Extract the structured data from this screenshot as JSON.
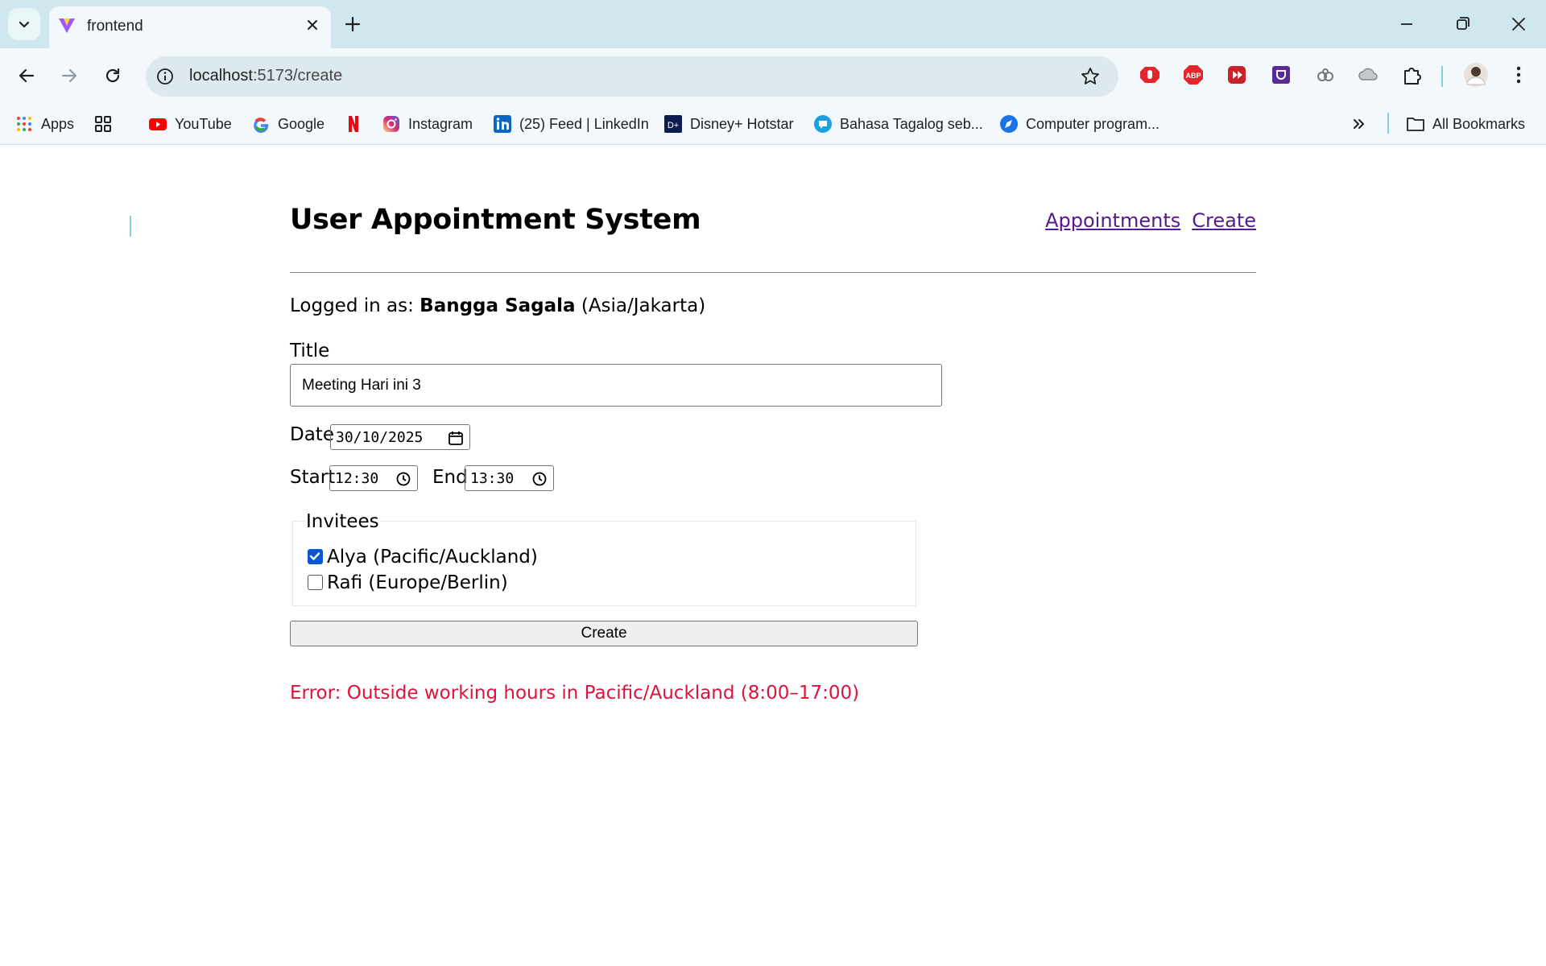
{
  "browser": {
    "tab_title": "frontend",
    "url_host": "localhost",
    "url_path": ":5173/create",
    "bookmarks": [
      {
        "label": "Apps",
        "icon": "apps-grid-icon"
      },
      {
        "label": "",
        "icon": "tab-groups-icon"
      },
      {
        "label": "YouTube",
        "icon": "youtube-icon"
      },
      {
        "label": "Google",
        "icon": "google-icon"
      },
      {
        "label": "",
        "icon": "netflix-icon"
      },
      {
        "label": "Instagram",
        "icon": "instagram-icon"
      },
      {
        "label": "(25) Feed | LinkedIn",
        "icon": "linkedin-icon"
      },
      {
        "label": "Disney+ Hotstar",
        "icon": "hotstar-icon"
      },
      {
        "label": "Bahasa Tagalog seb...",
        "icon": "chat-bubble-icon"
      },
      {
        "label": "Computer program...",
        "icon": "compass-icon"
      }
    ],
    "all_bookmarks_label": "All Bookmarks",
    "colors": {
      "tab_strip": "#cfe7ee",
      "toolbar": "#f2f8fb",
      "omnibox": "#dde9ee"
    }
  },
  "app": {
    "title": "User Appointment System",
    "nav": {
      "appointments": "Appointments",
      "create": "Create"
    },
    "logged_in_prefix": "Logged in as:",
    "user_name": "Bangga Sagala",
    "user_tz": "(Asia/Jakarta)",
    "form": {
      "title_label": "Title",
      "title_value": "Meeting Hari ini 3",
      "date_label": "Date",
      "date_value": "30/10/2025",
      "start_label": "Start",
      "start_value": "12:30",
      "end_label": "End",
      "end_value": "13:30",
      "invitees_legend": "Invitees",
      "invitees": [
        {
          "label": "Alya (Pacific/Auckland)",
          "checked": true
        },
        {
          "label": "Rafi (Europe/Berlin)",
          "checked": false
        }
      ],
      "submit_label": "Create"
    },
    "error": "Error: Outside working hours in Pacific/Auckland (8:00–17:00)",
    "colors": {
      "link": "#551a8b",
      "error": "#dc143c",
      "checkbox": "#0b57d0"
    }
  }
}
